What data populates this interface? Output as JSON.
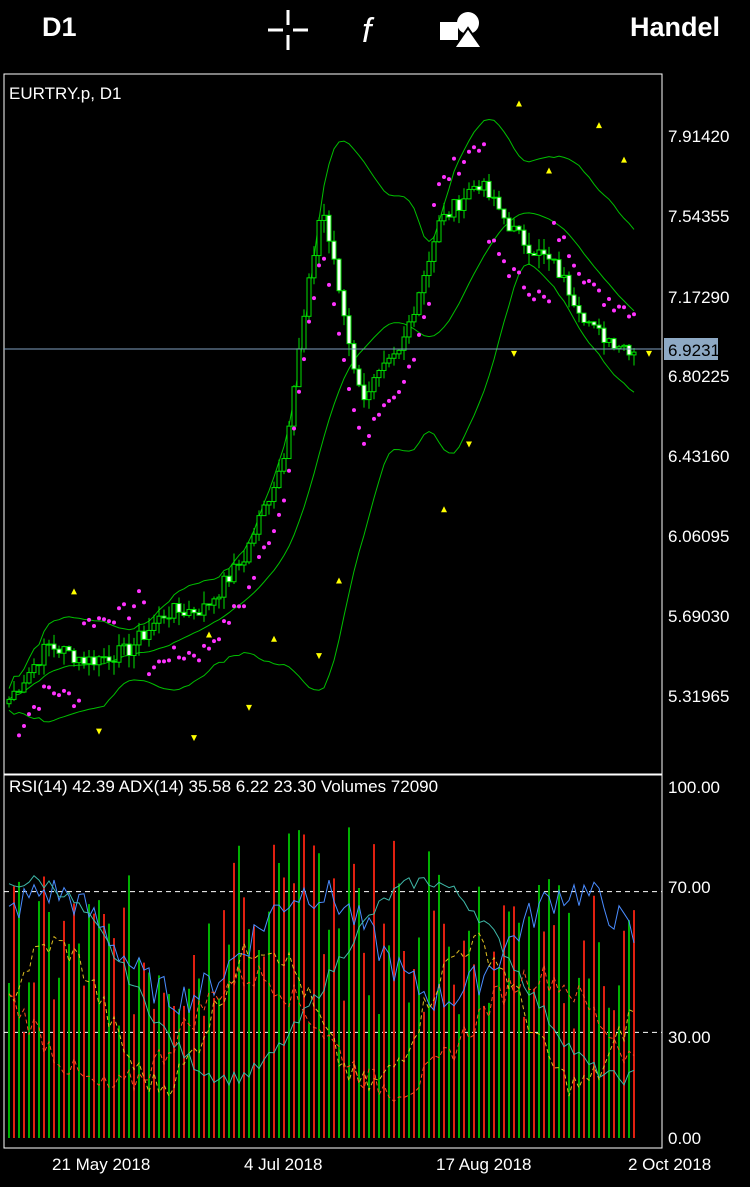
{
  "toolbar": {
    "timeframe": "D1",
    "crosshair_icon": "crosshair-icon",
    "indicators_icon": "function-icon",
    "objects_icon": "shapes-icon",
    "trade_label": "Handel"
  },
  "main_chart": {
    "symbol_label": "EURTRY.p, D1",
    "current_price": "6.92315",
    "price_ticks": [
      "7.91420",
      "7.54355",
      "7.17290",
      "6.80225",
      "6.43160",
      "6.06095",
      "5.69030",
      "5.31965"
    ]
  },
  "sub_chart": {
    "label": "RSI(14) 42.39 ADX(14) 35.58 6.22 23.30 Volumes 72090",
    "ticks": [
      "100.00",
      "70.00",
      "30.00",
      "0.00"
    ]
  },
  "time_axis": [
    "21 May 2018",
    "4 Jul 2018",
    "17 Aug 2018",
    "2 Oct 2018"
  ],
  "colors": {
    "bull_candle": "#00e000",
    "bear_candle": "#ffffff",
    "band": "#00c000",
    "sar": "#ff33ff",
    "fractal": "#ffff00",
    "rsi": "#4a8cff",
    "adx": "#3fb8a8",
    "di_plus": "#e0c020",
    "di_minus": "#ff5020",
    "volume_up": "#00b000",
    "volume_down": "#e02010",
    "grid": "#ffffff",
    "price_line": "#7f9fbf"
  },
  "chart_data": {
    "type": "candlestick",
    "symbol": "EURTRY.p",
    "timeframe": "D1",
    "x": [
      "21 May 2018",
      "4 Jul 2018",
      "17 Aug 2018",
      "2 Oct 2018"
    ],
    "close_approx": [
      5.3,
      5.55,
      5.48,
      5.52,
      5.7,
      5.72,
      5.95,
      6.4,
      7.6,
      6.7,
      6.9,
      7.5,
      7.7,
      7.45,
      7.3,
      7.0,
      6.92
    ],
    "last_price": 6.92315,
    "ylim": [
      5.1,
      8.05
    ],
    "indicators": {
      "RSI14": 42.39,
      "ADX14": 35.58,
      "DI_plus": 6.22,
      "DI_minus": 23.3,
      "Volume": 72090
    },
    "sub_ylim": [
      0,
      100
    ],
    "levels": [
      30,
      70
    ]
  }
}
